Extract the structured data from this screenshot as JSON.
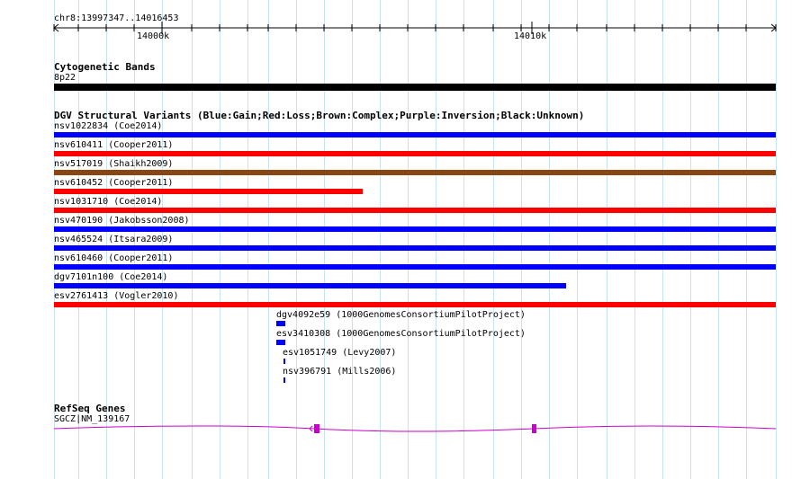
{
  "ruler": {
    "range_label": "chr8:13997347..14016453",
    "tick_labels": [
      "14000k",
      "14010k"
    ]
  },
  "cytobands": {
    "title": "Cytogenetic Bands",
    "band_label": "8p22",
    "color": "#000000"
  },
  "dgv": {
    "title": "DGV Structural Variants (Blue:Gain;Red:Loss;Brown:Complex;Purple:Inversion;Black:Unknown)",
    "colors": {
      "gain": "#0000ff",
      "loss": "#ff0000",
      "complex": "#8b4513",
      "inversion": "#800080",
      "unknown": "#000000"
    },
    "variants": [
      {
        "label": "nsv1022834 (Coe2014)",
        "type": "gain"
      },
      {
        "label": "nsv610411 (Cooper2011)",
        "type": "loss"
      },
      {
        "label": "nsv517019 (Shaikh2009)",
        "type": "complex"
      },
      {
        "label": "nsv610452 (Cooper2011)",
        "type": "loss"
      },
      {
        "label": "nsv1031710 (Coe2014)",
        "type": "loss"
      },
      {
        "label": "nsv470190 (Jakobsson2008)",
        "type": "gain"
      },
      {
        "label": "nsv465524 (Itsara2009)",
        "type": "gain"
      },
      {
        "label": "nsv610460 (Cooper2011)",
        "type": "gain"
      },
      {
        "label": "dgv7101n100 (Coe2014)",
        "type": "gain"
      },
      {
        "label": "esv2761413 (Vogler2010)",
        "type": "loss"
      },
      {
        "label": "dgv4092e59 (1000GenomesConsortiumPilotProject)",
        "type": "gain"
      },
      {
        "label": "esv3410308 (1000GenomesConsortiumPilotProject)",
        "type": "gain"
      },
      {
        "label": "esv1051749 (Levy2007)",
        "type": "gain"
      },
      {
        "label": "nsv396791 (Mills2006)",
        "type": "gain"
      }
    ]
  },
  "refseq": {
    "title": "RefSeq Genes",
    "gene_label": "SGCZ|NM_139167",
    "color": "#cc00cc"
  }
}
